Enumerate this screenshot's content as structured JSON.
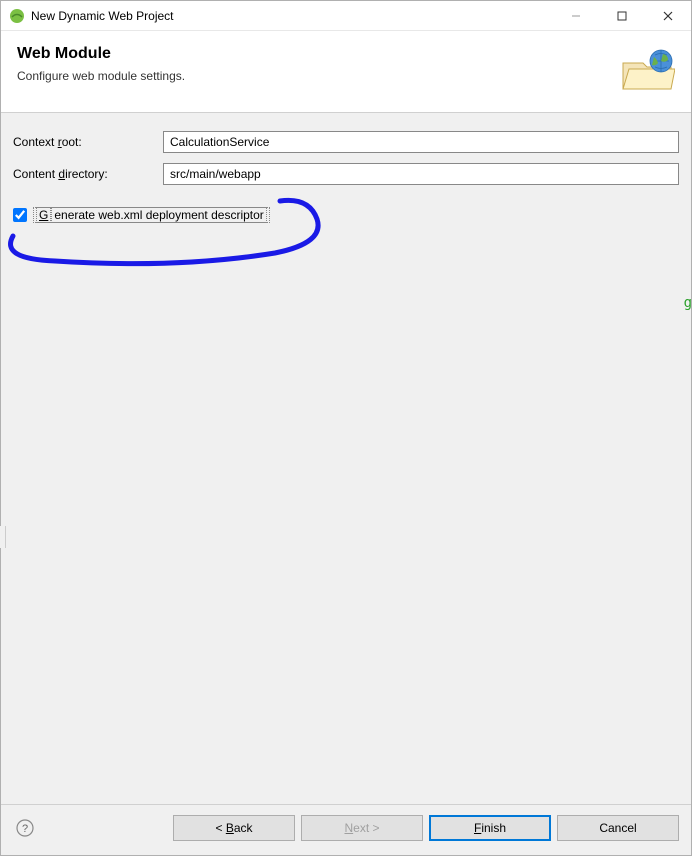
{
  "titlebar": {
    "title": "New Dynamic Web Project"
  },
  "header": {
    "heading": "Web Module",
    "subtitle": "Configure web module settings."
  },
  "form": {
    "context_root_label_pre": "Context ",
    "context_root_label_m": "r",
    "context_root_label_post": "oot:",
    "context_root_value": "CalculationService",
    "content_dir_label_pre": "Content ",
    "content_dir_label_m": "d",
    "content_dir_label_post": "irectory:",
    "content_dir_value": "src/main/webapp",
    "checkbox_label_m": "G",
    "checkbox_label_post": "enerate web.xml deployment descriptor"
  },
  "buttons": {
    "back_pre": "< ",
    "back_m": "B",
    "back_post": "ack",
    "next_m": "N",
    "next_post": "ext >",
    "finish_m": "F",
    "finish_post": "inish",
    "cancel": "Cancel"
  }
}
